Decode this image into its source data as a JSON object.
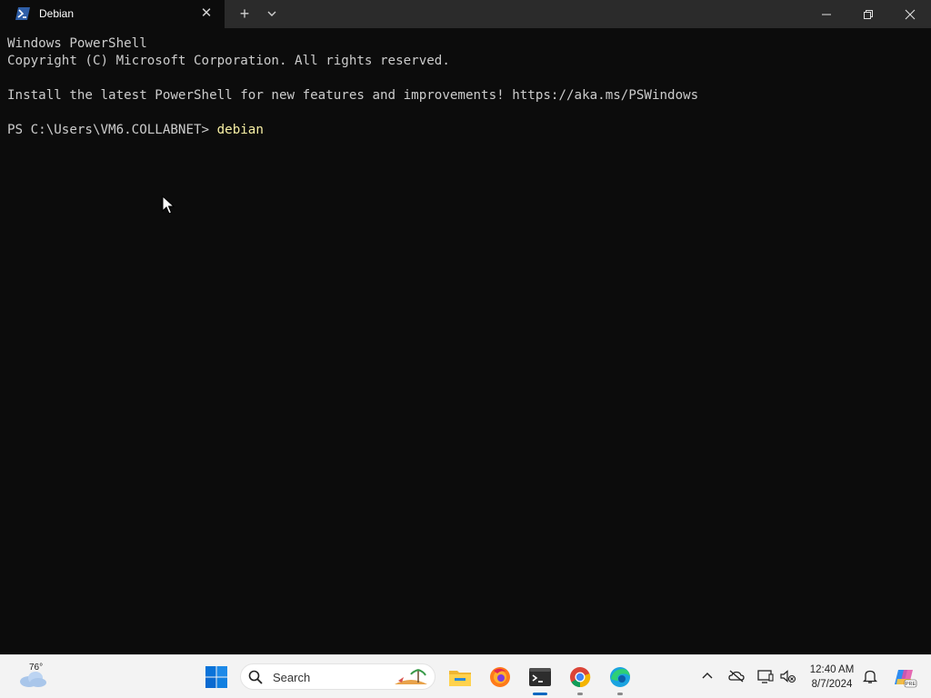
{
  "window": {
    "tab_title": "Debian",
    "tab_icon": "powershell-icon",
    "new_tab_icon": "plus-icon",
    "dropdown_icon": "chevron-down-icon",
    "minimize_icon": "minimize-icon",
    "maximize_icon": "restore-icon",
    "close_icon": "close-icon"
  },
  "terminal": {
    "lines": [
      "Windows PowerShell",
      "Copyright (C) Microsoft Corporation. All rights reserved.",
      "",
      "Install the latest PowerShell for new features and improvements! https://aka.ms/PSWindows",
      ""
    ],
    "prompt": "PS C:\\Users\\VM6.COLLABNET> ",
    "command": "debian",
    "colors": {
      "background": "#0c0c0c",
      "text": "#cccccc",
      "command": "#f9f1a5"
    }
  },
  "taskbar": {
    "weather_temp": "76°",
    "search_placeholder": "Search",
    "apps": [
      "start-icon",
      "search-icon",
      "file-explorer-icon",
      "firefox-icon",
      "terminal-icon",
      "chrome-icon",
      "edge-icon"
    ],
    "tray": [
      "chevron-up-icon",
      "onedrive-icon",
      "display-icon",
      "speaker-icon"
    ],
    "clock": {
      "time": "12:40 AM",
      "date": "8/7/2024"
    },
    "accent_color": "#0067c0"
  }
}
